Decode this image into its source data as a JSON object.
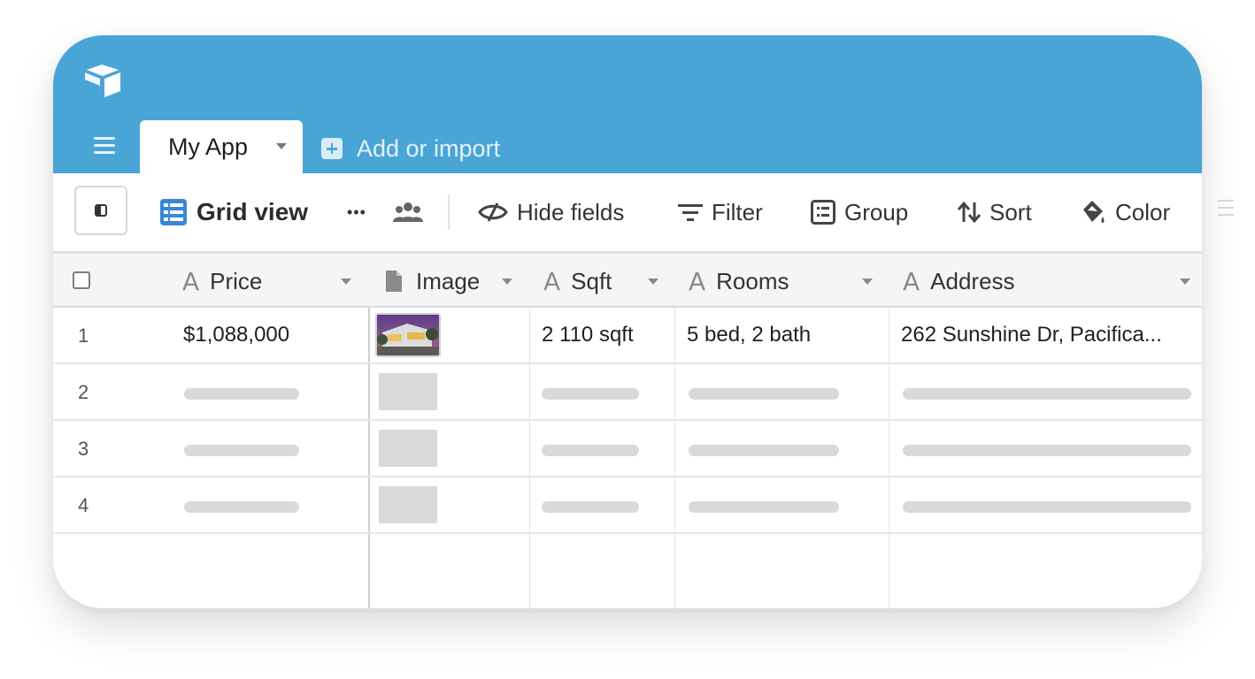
{
  "app": {
    "logo": "airtable-logo-icon",
    "colors": {
      "accent": "#4aa5d7",
      "placeholder": "#d9d9d9"
    }
  },
  "tabs": {
    "active": "My App",
    "add_import": "Add or import"
  },
  "toolbar": {
    "view_name": "Grid view",
    "more": "•••",
    "hide_fields": "Hide fields",
    "filter": "Filter",
    "group": "Group",
    "sort": "Sort",
    "color": "Color"
  },
  "table": {
    "columns": [
      {
        "label": "Price",
        "icon": "text-field-icon"
      },
      {
        "label": "Image",
        "icon": "attachment-field-icon"
      },
      {
        "label": "Sqft",
        "icon": "text-field-icon"
      },
      {
        "label": "Rooms",
        "icon": "text-field-icon"
      },
      {
        "label": "Address",
        "icon": "text-field-icon"
      }
    ],
    "rows": [
      {
        "num": "1",
        "price": "$1,088,000",
        "image": "house-photo-thumbnail",
        "sqft": "2 110 sqft",
        "rooms": "5 bed, 2 bath",
        "address": "262 Sunshine Dr, Pacifica..."
      },
      {
        "num": "2"
      },
      {
        "num": "3"
      },
      {
        "num": "4"
      }
    ]
  }
}
